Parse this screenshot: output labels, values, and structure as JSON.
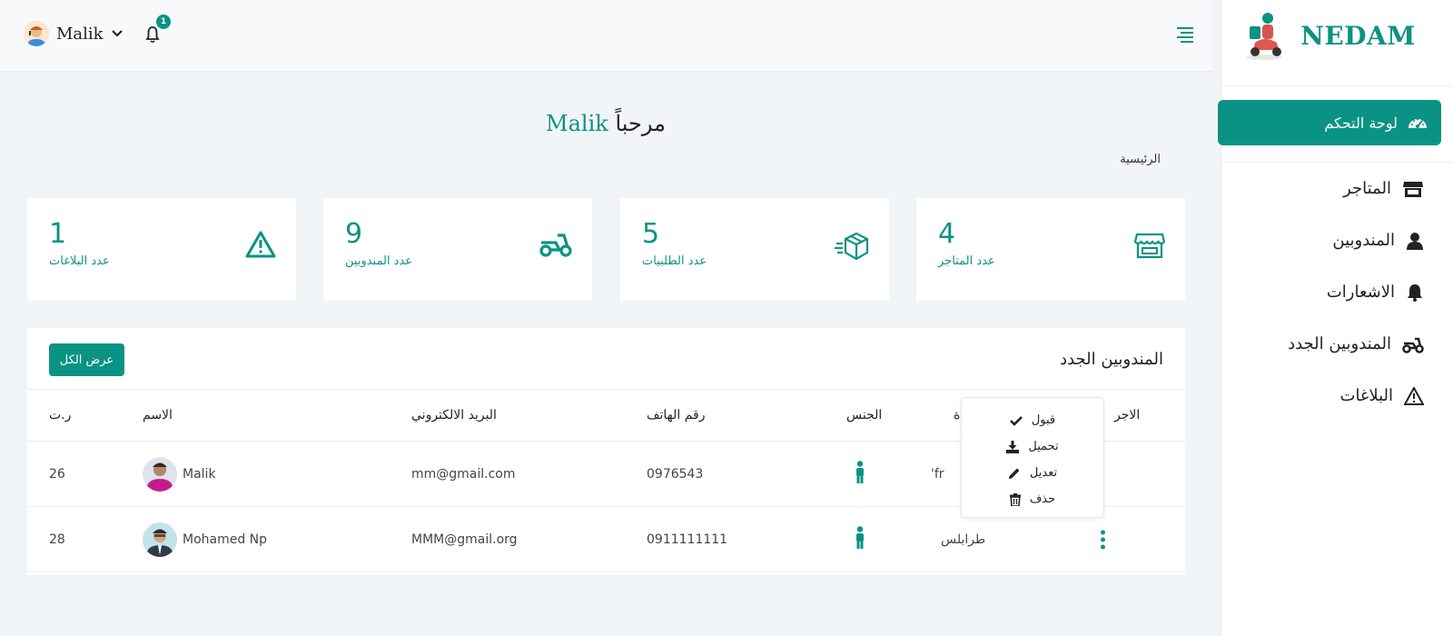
{
  "brand": {
    "name": "NEDAM",
    "color": "#0a9384"
  },
  "topbar": {
    "user_name": "Malik",
    "notification_count": "1"
  },
  "sidebar": {
    "active": {
      "label": "لوحة التحكم",
      "icon": "speedometer-icon"
    },
    "items": [
      {
        "label": "المتاجر",
        "icon": "store-icon"
      },
      {
        "label": "المندوبين",
        "icon": "user-icon"
      },
      {
        "label": "الاشعارات",
        "icon": "bell-icon"
      },
      {
        "label": "المندوبين الجدد",
        "icon": "scooter-icon"
      },
      {
        "label": "البلاغات",
        "icon": "warning-icon"
      }
    ]
  },
  "welcome": {
    "greeting": "مرحباً",
    "name": "Malik"
  },
  "breadcrumb": "الرئيسية",
  "stats": [
    {
      "value": "4",
      "label": "عدد المتاجر",
      "icon": "store-icon"
    },
    {
      "value": "5",
      "label": "عدد الطلبيات",
      "icon": "fast-box-icon"
    },
    {
      "value": "9",
      "label": "عدد المندوبين",
      "icon": "scooter-icon"
    },
    {
      "value": "1",
      "label": "عدد البلاغات",
      "icon": "warning-icon"
    }
  ],
  "table": {
    "title": "المندوبين الجدد",
    "view_all": "عرض الكل",
    "headers": {
      "num": "ر.ت",
      "name": "الاسم",
      "email": "البريد الالكتروني",
      "phone": "رقم الهاتف",
      "gender": "الجنس",
      "city": "ة",
      "actions": "الاجر"
    },
    "rows": [
      {
        "num": "26",
        "name": "Malik",
        "email": "mm@gmail.com",
        "phone": "0976543",
        "city": "'fr"
      },
      {
        "num": "28",
        "name": "Mohamed Np",
        "email": "MMM@gmail.org",
        "phone": "0911111111",
        "city": "طرابلس"
      }
    ]
  },
  "dropdown": {
    "items": [
      {
        "label": "قبول",
        "icon": "check-icon"
      },
      {
        "label": "تحميل",
        "icon": "download-icon"
      },
      {
        "label": "تعديل",
        "icon": "pencil-icon"
      },
      {
        "label": "حذف",
        "icon": "trash-icon"
      }
    ]
  }
}
